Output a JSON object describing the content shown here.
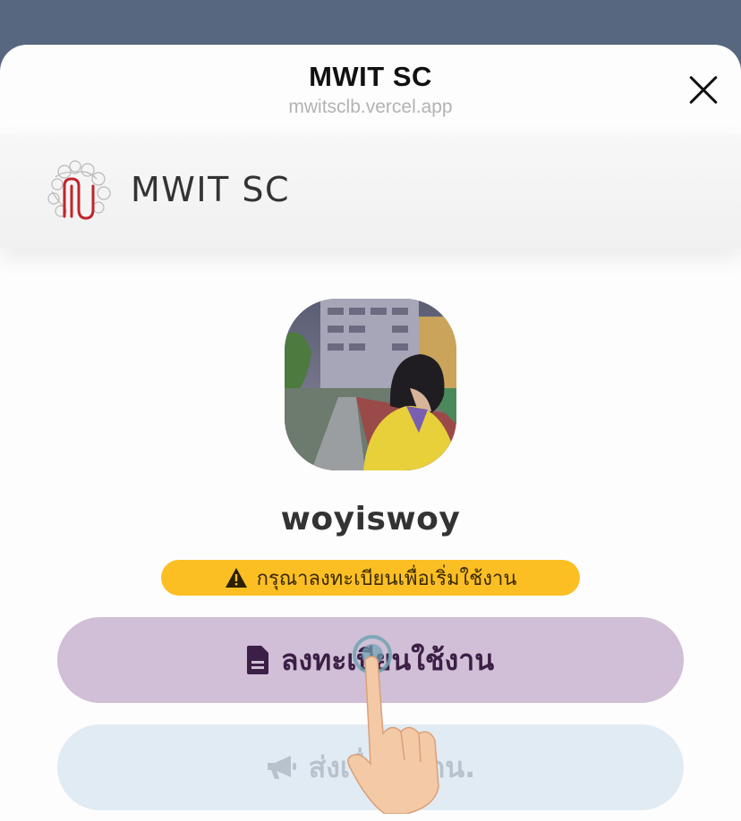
{
  "sheet": {
    "title": "MWIT SC",
    "url": "mwitsclb.vercel.app"
  },
  "header": {
    "brand": "MWIT SC"
  },
  "profile": {
    "username": "woyiswoy",
    "warning": "กรุณาลงทะเบียนเพื่อเริ่มใช้งาน"
  },
  "actions": {
    "register_label": "ลงทะเบียนใช้งาน",
    "report_label": "ส่งเรื่องถึงกน."
  },
  "icons": {
    "close": "close-icon",
    "warning": "warning-triangle-icon",
    "register": "document-icon",
    "report": "megaphone-icon",
    "tap": "tap-hand-icon"
  },
  "colors": {
    "backdrop": "#56677f",
    "warning_bg": "#fbbf24",
    "register_bg": "#d0bfd6",
    "register_text": "#3c1f47",
    "report_bg": "#e1ebf3",
    "logo_red": "#c0242b"
  }
}
